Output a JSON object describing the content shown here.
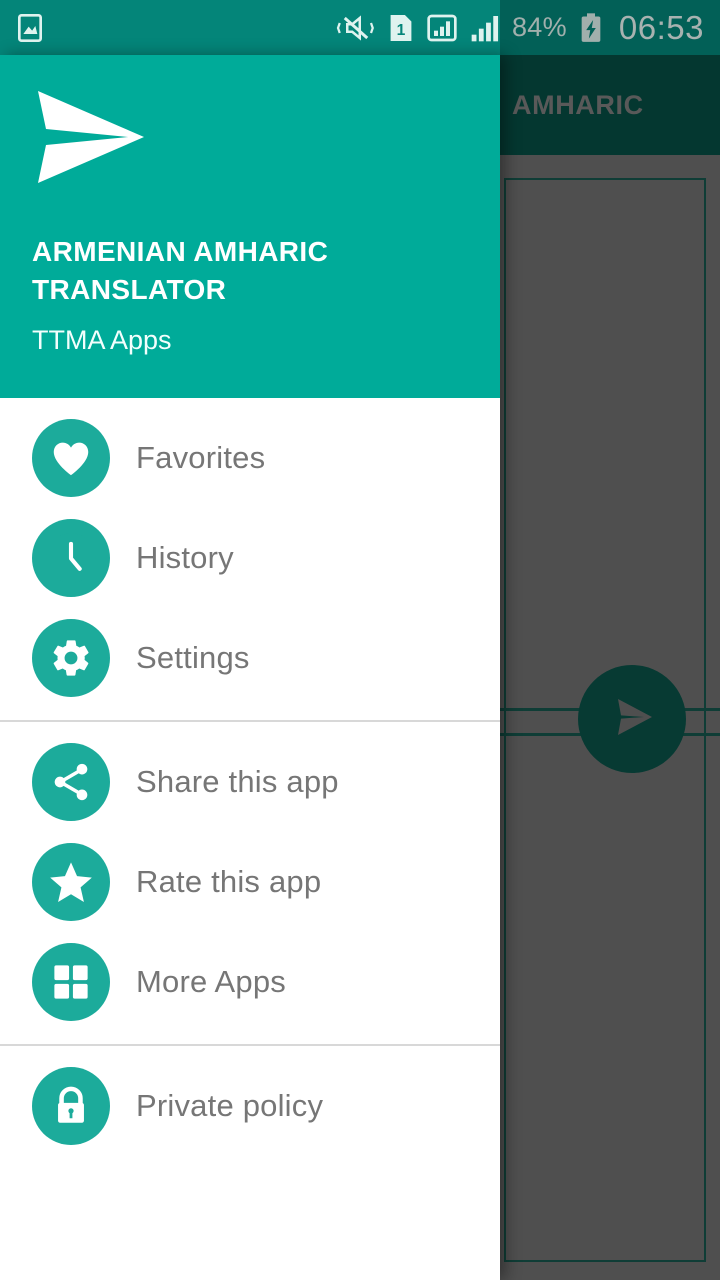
{
  "status_bar": {
    "notification_icon": "photo-image-icon",
    "icons": [
      "vibrate-mute-icon",
      "sim-1-icon",
      "signal-bars-boxed-icon",
      "signal-bars-icon"
    ],
    "battery_percent": "84%",
    "battery_icon": "battery-charging-icon",
    "clock": "06:53",
    "background_color": "#048579",
    "text_color": "#e9f7f4"
  },
  "background_activity": {
    "appbar_title": "AMHARIC",
    "appbar_color": "#064d43",
    "appbar_title_color": "#7c7c7c",
    "fab_icon": "send-icon",
    "fab_color": "#0a5147",
    "scrim_color": "rgba(0,0,0,0.28)"
  },
  "drawer": {
    "background_color": "#ffffff",
    "header": {
      "logo_icon": "paper-plane-send-logo",
      "title": "ARMENIAN AMHARIC TRANSLATOR",
      "subtitle": "TTMA Apps",
      "background_color": "#00ab99",
      "title_color": "#ffffff"
    },
    "accent_color": "#1cab9b",
    "label_color": "#767676",
    "groups": [
      {
        "items": [
          {
            "label": "Favorites",
            "icon": "heart-icon"
          },
          {
            "label": "History",
            "icon": "clock-icon"
          },
          {
            "label": "Settings",
            "icon": "gear-icon"
          }
        ]
      },
      {
        "items": [
          {
            "label": "Share this app",
            "icon": "share-icon"
          },
          {
            "label": "Rate this app",
            "icon": "star-icon"
          },
          {
            "label": "More Apps",
            "icon": "grid-apps-icon"
          }
        ]
      },
      {
        "items": [
          {
            "label": "Private policy",
            "icon": "lock-icon"
          }
        ]
      }
    ]
  }
}
